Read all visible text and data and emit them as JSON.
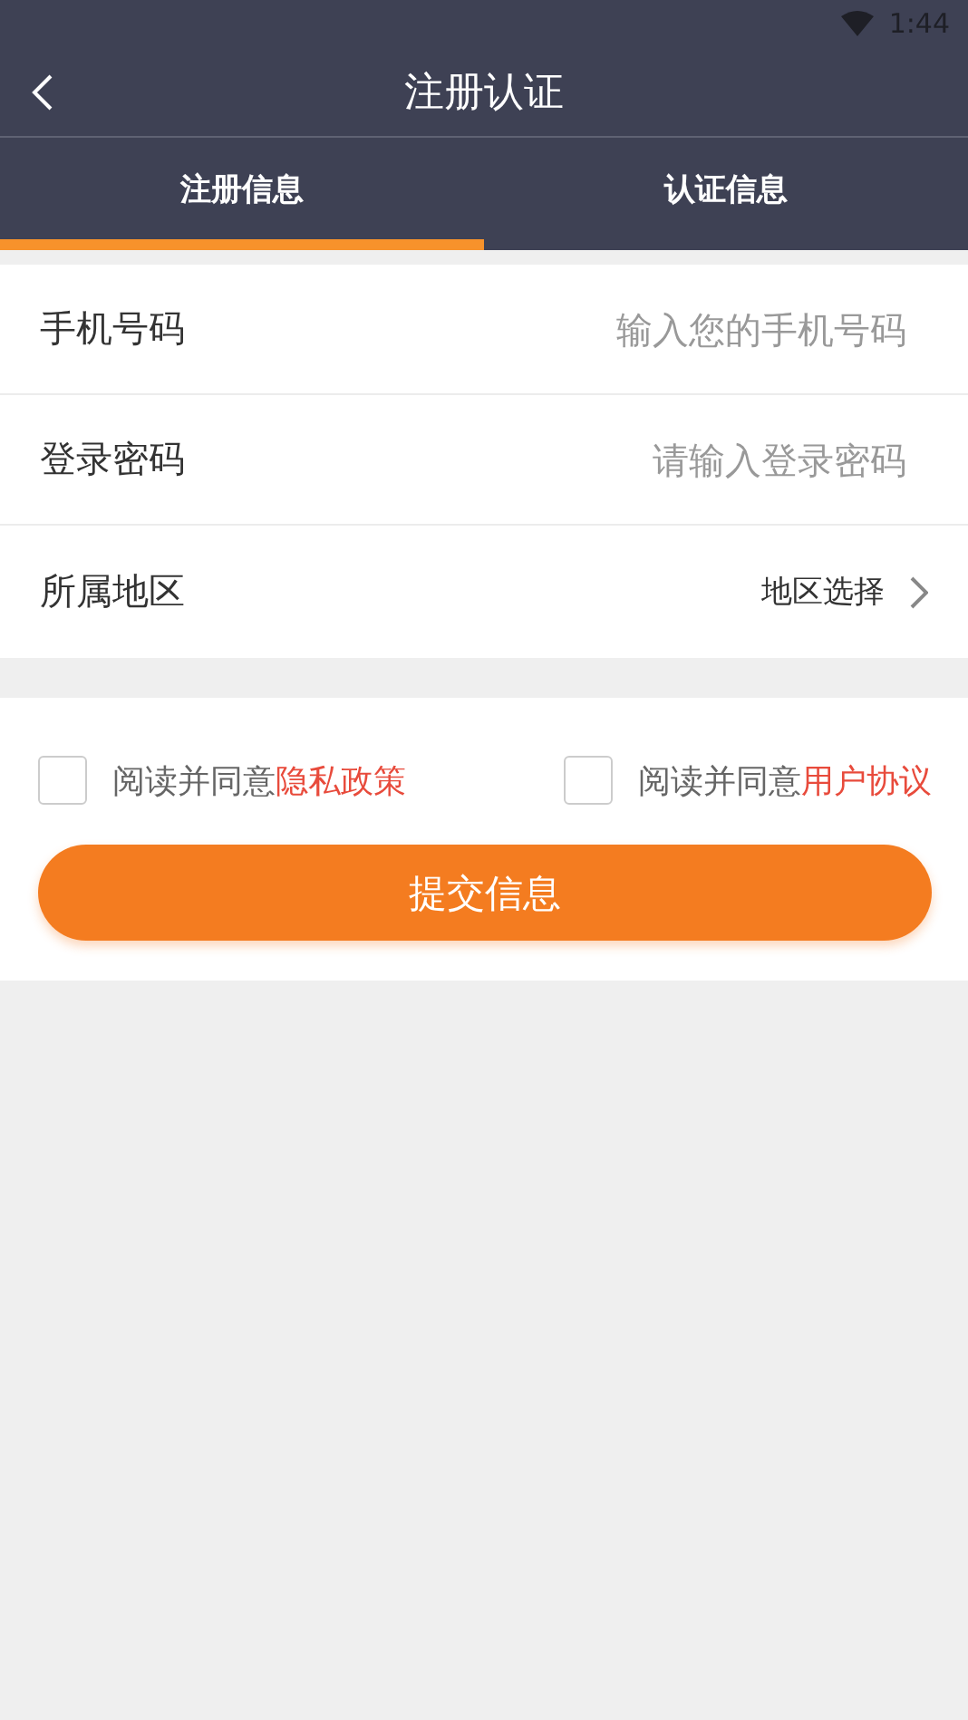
{
  "status_bar": {
    "time": "1:44"
  },
  "nav": {
    "title": "注册认证"
  },
  "tabs": [
    {
      "label": "注册信息",
      "selected": true
    },
    {
      "label": "认证信息",
      "selected": false
    }
  ],
  "form": [
    {
      "kind": "input",
      "label": "手机号码",
      "placeholder": "输入您的手机号码"
    },
    {
      "kind": "input",
      "label": "登录密码",
      "placeholder": "请输入登录密码"
    },
    {
      "kind": "select",
      "label": "所属地区",
      "value": "地区选择"
    }
  ],
  "agreements": [
    {
      "text": "阅读并同意",
      "link": "隐私政策",
      "checked": false
    },
    {
      "text": "阅读并同意",
      "link": "用户协议",
      "checked": false
    }
  ],
  "submit": {
    "label": "提交信息"
  }
}
